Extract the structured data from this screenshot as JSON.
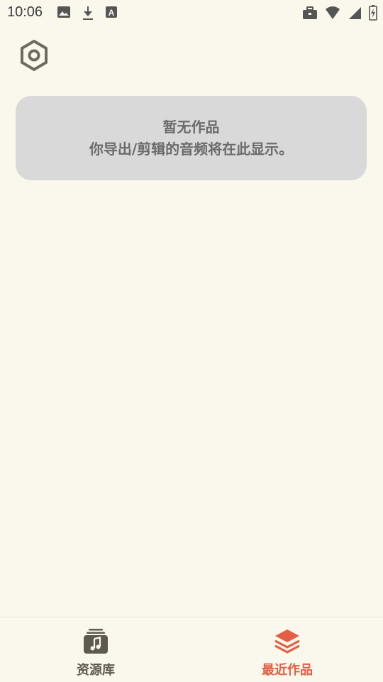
{
  "status_bar": {
    "time": "10:06",
    "left_icons": [
      "image-icon",
      "download-icon",
      "font-a-icon"
    ],
    "right_icons": [
      "briefcase-icon",
      "wifi-icon",
      "signal-icon",
      "battery-charging-icon"
    ]
  },
  "toolbar": {
    "settings_icon": "hexagon-settings-icon"
  },
  "empty_state": {
    "title": "暂无作品",
    "description": "你导出/剪辑的音频将在此显示。"
  },
  "bottom_nav": {
    "items": [
      {
        "label": "资源库",
        "icon": "music-library-icon",
        "active": false
      },
      {
        "label": "最近作品",
        "icon": "layers-icon",
        "active": true
      }
    ]
  },
  "colors": {
    "background": "#FAF7EC",
    "card": "#D9D9D9",
    "card_text": "#6B6B6B",
    "accent": "#E45E44",
    "inactive": "#5E5A50"
  }
}
